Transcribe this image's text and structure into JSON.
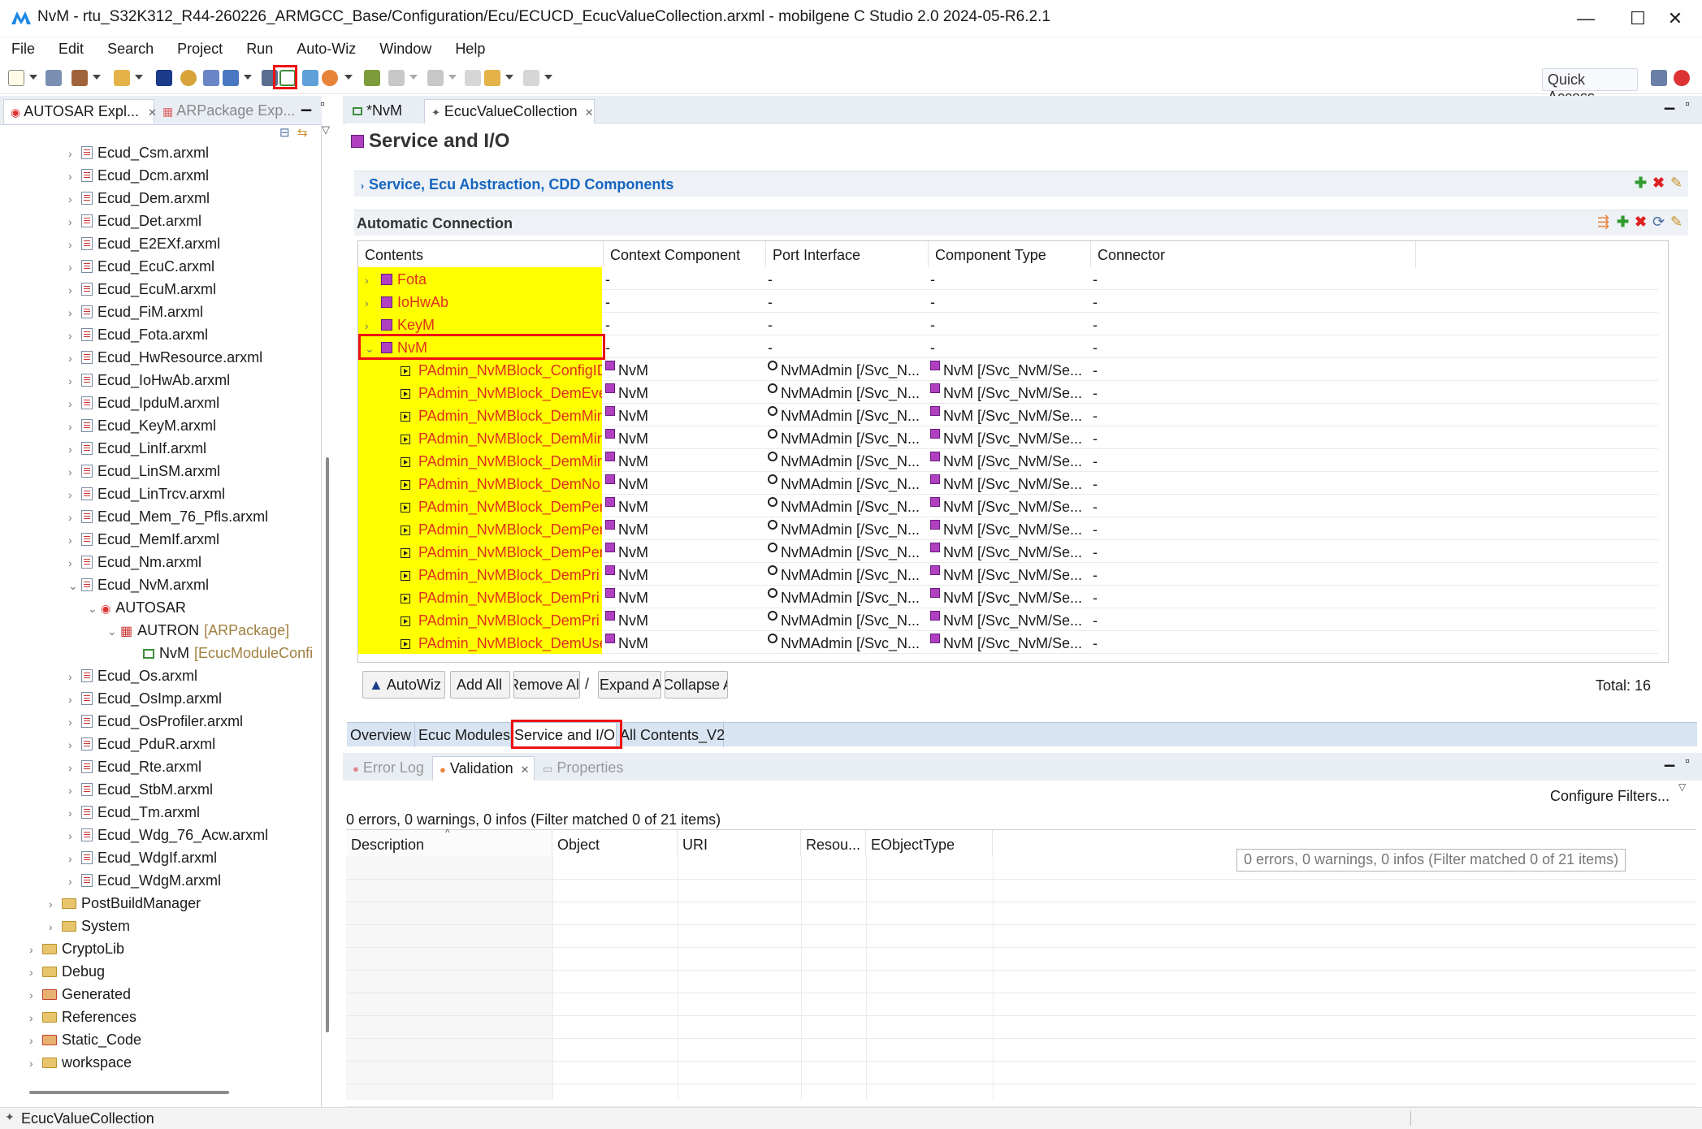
{
  "window": {
    "title": "NvM - rtu_S32K312_R44-260226_ARMGCC_Base/Configuration/Ecu/ECUCD_EcucValueCollection.arxml - mobilgene C Studio 2.0 2024-05-R6.2.1",
    "minimize": "—",
    "maximize": "☐",
    "close": "✕"
  },
  "menu": [
    "File",
    "Edit",
    "Search",
    "Project",
    "Run",
    "Auto-Wiz",
    "Window",
    "Help"
  ],
  "quick_access": "Quick Access",
  "left": {
    "tabs": [
      "AUTOSAR Expl...",
      "ARPackage Exp..."
    ],
    "tree": [
      {
        "label": "Ecud_Csm.arxml",
        "indent": 0,
        "kind": "file"
      },
      {
        "label": "Ecud_Dcm.arxml",
        "indent": 0,
        "kind": "file"
      },
      {
        "label": "Ecud_Dem.arxml",
        "indent": 0,
        "kind": "file"
      },
      {
        "label": "Ecud_Det.arxml",
        "indent": 0,
        "kind": "file"
      },
      {
        "label": "Ecud_E2EXf.arxml",
        "indent": 0,
        "kind": "file"
      },
      {
        "label": "Ecud_EcuC.arxml",
        "indent": 0,
        "kind": "file"
      },
      {
        "label": "Ecud_EcuM.arxml",
        "indent": 0,
        "kind": "file"
      },
      {
        "label": "Ecud_FiM.arxml",
        "indent": 0,
        "kind": "file"
      },
      {
        "label": "Ecud_Fota.arxml",
        "indent": 0,
        "kind": "file"
      },
      {
        "label": "Ecud_HwResource.arxml",
        "indent": 0,
        "kind": "file"
      },
      {
        "label": "Ecud_IoHwAb.arxml",
        "indent": 0,
        "kind": "file"
      },
      {
        "label": "Ecud_IpduM.arxml",
        "indent": 0,
        "kind": "file"
      },
      {
        "label": "Ecud_KeyM.arxml",
        "indent": 0,
        "kind": "file"
      },
      {
        "label": "Ecud_LinIf.arxml",
        "indent": 0,
        "kind": "file"
      },
      {
        "label": "Ecud_LinSM.arxml",
        "indent": 0,
        "kind": "file"
      },
      {
        "label": "Ecud_LinTrcv.arxml",
        "indent": 0,
        "kind": "file"
      },
      {
        "label": "Ecud_Mem_76_Pfls.arxml",
        "indent": 0,
        "kind": "file"
      },
      {
        "label": "Ecud_MemIf.arxml",
        "indent": 0,
        "kind": "file"
      },
      {
        "label": "Ecud_Nm.arxml",
        "indent": 0,
        "kind": "file"
      },
      {
        "label": "Ecud_NvM.arxml",
        "indent": 0,
        "kind": "file-open"
      },
      {
        "label": "AUTOSAR",
        "indent": 1,
        "kind": "autosar"
      },
      {
        "label": "AUTRON",
        "suffix": "[ARPackage]",
        "indent": 2,
        "kind": "package"
      },
      {
        "label": "NvM",
        "suffix": "[EcucModuleConfi",
        "indent": 3,
        "kind": "module"
      },
      {
        "label": "Ecud_Os.arxml",
        "indent": 0,
        "kind": "file"
      },
      {
        "label": "Ecud_OsImp.arxml",
        "indent": 0,
        "kind": "file"
      },
      {
        "label": "Ecud_OsProfiler.arxml",
        "indent": 0,
        "kind": "file"
      },
      {
        "label": "Ecud_PduR.arxml",
        "indent": 0,
        "kind": "file"
      },
      {
        "label": "Ecud_Rte.arxml",
        "indent": 0,
        "kind": "file"
      },
      {
        "label": "Ecud_StbM.arxml",
        "indent": 0,
        "kind": "file"
      },
      {
        "label": "Ecud_Tm.arxml",
        "indent": 0,
        "kind": "file"
      },
      {
        "label": "Ecud_Wdg_76_Acw.arxml",
        "indent": 0,
        "kind": "file"
      },
      {
        "label": "Ecud_WdgIf.arxml",
        "indent": 0,
        "kind": "file"
      },
      {
        "label": "Ecud_WdgM.arxml",
        "indent": 0,
        "kind": "file"
      },
      {
        "label": "PostBuildManager",
        "indent": -1,
        "kind": "folder"
      },
      {
        "label": "System",
        "indent": -1,
        "kind": "folder"
      },
      {
        "label": "CryptoLib",
        "indent": -2,
        "kind": "folder"
      },
      {
        "label": "Debug",
        "indent": -2,
        "kind": "folder"
      },
      {
        "label": "Generated",
        "indent": -2,
        "kind": "folder-red"
      },
      {
        "label": "References",
        "indent": -2,
        "kind": "folder"
      },
      {
        "label": "Static_Code",
        "indent": -2,
        "kind": "folder-red"
      },
      {
        "label": "workspace",
        "indent": -2,
        "kind": "folder"
      }
    ]
  },
  "editor": {
    "tabs": [
      "*NvM",
      "EcucValueCollection"
    ],
    "form_title": "Service and I/O",
    "section1": "Service, Ecu Abstraction, CDD Components",
    "section2": "Automatic Connection",
    "columns": [
      "Contents",
      "Context Component",
      "Port Interface",
      "Component Type",
      "Connector"
    ],
    "rows": [
      {
        "contents": "Fota",
        "level": 0,
        "expander": "›",
        "ctx": "-",
        "port": "-",
        "ctype": "-",
        "conn": "-"
      },
      {
        "contents": "IoHwAb",
        "level": 0,
        "expander": "›",
        "ctx": "-",
        "port": "-",
        "ctype": "-",
        "conn": "-"
      },
      {
        "contents": "KeyM",
        "level": 0,
        "expander": "›",
        "ctx": "-",
        "port": "-",
        "ctype": "-",
        "conn": "-"
      },
      {
        "contents": "NvM",
        "level": 0,
        "expander": "⌄",
        "ctx": "-",
        "port": "-",
        "ctype": "-",
        "conn": "-"
      },
      {
        "contents": "PAdmin_NvMBlock_ConfigID",
        "level": 1,
        "ctx": "NvM",
        "port": "NvMAdmin [/Svc_N...",
        "ctype": "NvM [/Svc_NvM/Se...",
        "conn": "-"
      },
      {
        "contents": "PAdmin_NvMBlock_DemEve",
        "level": 1,
        "ctx": "NvM",
        "port": "NvMAdmin [/Svc_N...",
        "ctype": "NvM [/Svc_NvM/Se...",
        "conn": "-"
      },
      {
        "contents": "PAdmin_NvMBlock_DemMir",
        "level": 1,
        "ctx": "NvM",
        "port": "NvMAdmin [/Svc_N...",
        "ctype": "NvM [/Svc_NvM/Se...",
        "conn": "-"
      },
      {
        "contents": "PAdmin_NvMBlock_DemMir",
        "level": 1,
        "ctx": "NvM",
        "port": "NvMAdmin [/Svc_N...",
        "ctype": "NvM [/Svc_NvM/Se...",
        "conn": "-"
      },
      {
        "contents": "PAdmin_NvMBlock_DemMir",
        "level": 1,
        "ctx": "NvM",
        "port": "NvMAdmin [/Svc_N...",
        "ctype": "NvM [/Svc_NvM/Se...",
        "conn": "-"
      },
      {
        "contents": "PAdmin_NvMBlock_DemNo",
        "level": 1,
        "ctx": "NvM",
        "port": "NvMAdmin [/Svc_N...",
        "ctype": "NvM [/Svc_NvM/Se...",
        "conn": "-"
      },
      {
        "contents": "PAdmin_NvMBlock_DemPer",
        "level": 1,
        "ctx": "NvM",
        "port": "NvMAdmin [/Svc_N...",
        "ctype": "NvM [/Svc_NvM/Se...",
        "conn": "-"
      },
      {
        "contents": "PAdmin_NvMBlock_DemPer",
        "level": 1,
        "ctx": "NvM",
        "port": "NvMAdmin [/Svc_N...",
        "ctype": "NvM [/Svc_NvM/Se...",
        "conn": "-"
      },
      {
        "contents": "PAdmin_NvMBlock_DemPer",
        "level": 1,
        "ctx": "NvM",
        "port": "NvMAdmin [/Svc_N...",
        "ctype": "NvM [/Svc_NvM/Se...",
        "conn": "-"
      },
      {
        "contents": "PAdmin_NvMBlock_DemPri",
        "level": 1,
        "ctx": "NvM",
        "port": "NvMAdmin [/Svc_N...",
        "ctype": "NvM [/Svc_NvM/Se...",
        "conn": "-"
      },
      {
        "contents": "PAdmin_NvMBlock_DemPri",
        "level": 1,
        "ctx": "NvM",
        "port": "NvMAdmin [/Svc_N...",
        "ctype": "NvM [/Svc_NvM/Se...",
        "conn": "-"
      },
      {
        "contents": "PAdmin_NvMBlock_DemPri",
        "level": 1,
        "ctx": "NvM",
        "port": "NvMAdmin [/Svc_N...",
        "ctype": "NvM [/Svc_NvM/Se...",
        "conn": "-"
      },
      {
        "contents": "PAdmin_NvMBlock_DemUse",
        "level": 1,
        "ctx": "NvM",
        "port": "NvMAdmin [/Svc_N...",
        "ctype": "NvM [/Svc_NvM/Se...",
        "conn": "-"
      }
    ],
    "buttons": [
      "AutoWiz",
      "Add All",
      "Remove All",
      "Expand All",
      "Collapse All"
    ],
    "total": "Total: 16",
    "page_tabs": [
      "Overview",
      "Ecuc Modules",
      "Service and I/O",
      "All Contents_V2"
    ]
  },
  "bottom": {
    "tabs": [
      "Error Log",
      "Validation",
      "Properties"
    ],
    "configure": "Configure Filters...",
    "summary": "0 errors, 0 warnings, 0 infos (Filter matched 0 of 21 items)",
    "tooltip": "0 errors, 0 warnings, 0 infos (Filter matched 0 of 21 items)",
    "columns": [
      "Description",
      "Object",
      "URI",
      "Resou...",
      "EObjectType"
    ]
  },
  "status": "EcucValueCollection",
  "colors": {
    "highlight": "#ffff00",
    "red_text": "#e0301e",
    "link_blue": "#1565c0",
    "annotation_red": "#e11111"
  }
}
